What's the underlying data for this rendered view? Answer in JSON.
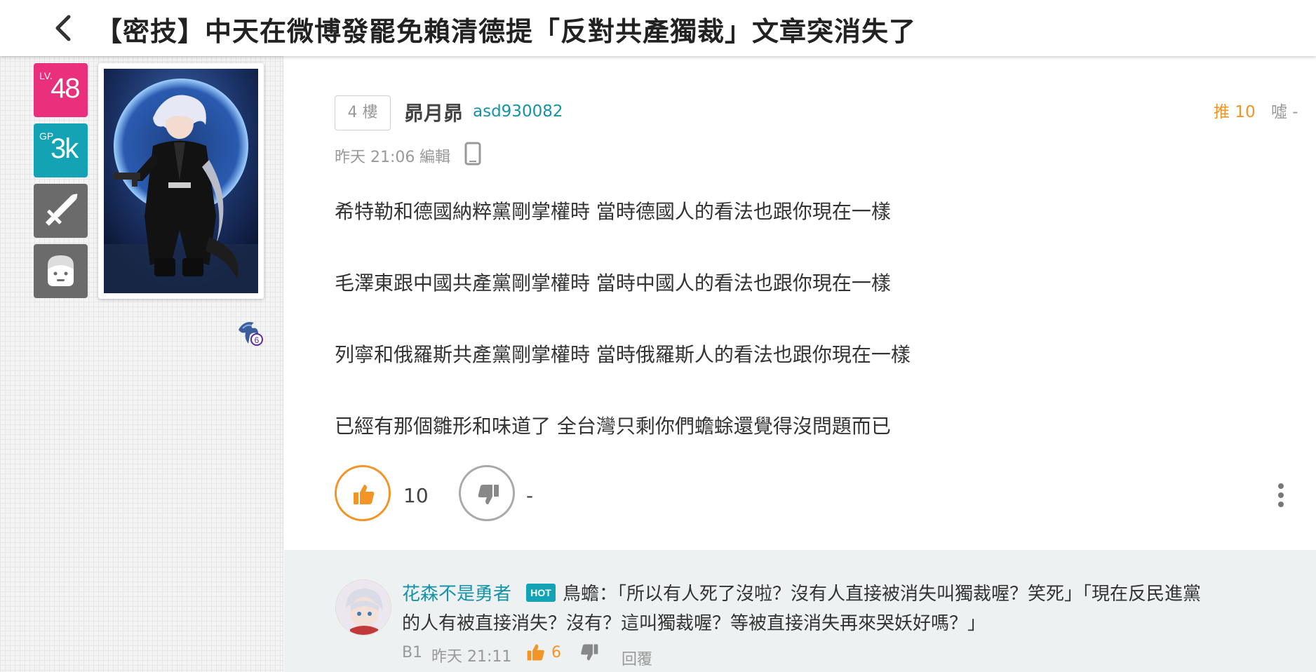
{
  "header": {
    "title": "【密技】中天在微博發罷免賴清德提「反對共產獨裁」文章突消失了"
  },
  "sidebar": {
    "level_prefix": "LV.",
    "level": "48",
    "gp_prefix": "GP",
    "gp": "3k",
    "guild_badge_num": "6"
  },
  "post": {
    "floor": "4 樓",
    "author_name": "昴月昴",
    "author_id": "asd930082",
    "push": "推 10",
    "boo": "噓 -",
    "time": "昨天 21:06",
    "edit": "編輯",
    "lines": [
      "希特勒和德國納粹黨剛掌權時 當時德國人的看法也跟你現在一樣",
      "毛澤東跟中國共產黨剛掌權時 當時中國人的看法也跟你現在一樣",
      "列寧和俄羅斯共產黨剛掌權時 當時俄羅斯人的看法也跟你現在一樣",
      "已經有那個雛形和味道了 全台灣只剩你們蟾蜍還覺得沒問題而已"
    ],
    "like_count": "10",
    "dislike_count": "-"
  },
  "comment": {
    "user": "花森不是勇者",
    "hot_label": "HOT",
    "text_line1": "鳥蟾：「所以有人死了沒啦？沒有人直接被消失叫獨裁喔？笑死」「現在反民進黨",
    "text_line2": "的人有被直接消失？沒有？這叫獨裁喔？等被直接消失再來哭妖好嗎？」",
    "floor": "B1",
    "time": "昨天 21:11",
    "like_count": "6",
    "reply_label": "回覆"
  },
  "colors": {
    "accent_orange": "#f39526",
    "teal": "#1593a8",
    "level_pink": "#ea2f7d",
    "gp_teal": "#13a3b5"
  },
  "icons": [
    "back-arrow-icon",
    "sword-icon",
    "face-icon",
    "guild-icon",
    "mobile-icon",
    "thumbs-up-icon",
    "thumbs-down-icon",
    "more-vertical-icon"
  ]
}
